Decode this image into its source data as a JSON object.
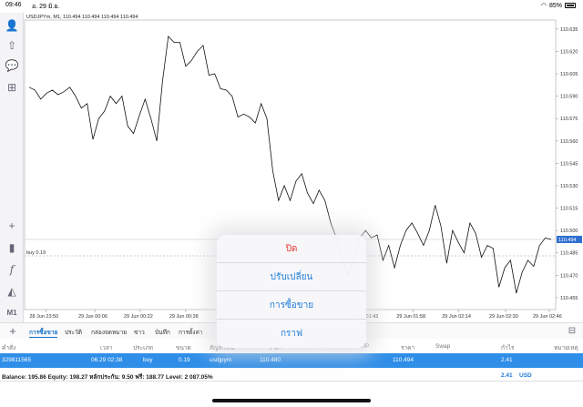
{
  "status": {
    "time": "09:46",
    "date": "อ. 29 มิ.ย.",
    "battery": "85%"
  },
  "chart": {
    "symbol_header": "USDJPYm, M1, 110.494 110.494 110.494 110.494",
    "price_labels": [
      "110.635",
      "110.620",
      "110.605",
      "110.590",
      "110.575",
      "110.560",
      "110.545",
      "110.530",
      "110.515",
      "110.500",
      "110.485",
      "110.470",
      "110.455"
    ],
    "current_price": "110.494",
    "order_line_label": "buy 0.19",
    "time_labels": [
      "28 Jun 23:50",
      "29 Jun 00:06",
      "29 Jun 00:22",
      "29 Jun 00:38",
      "29 Jun 01:42",
      "29 Jun 01:58",
      "29 Jun 02:14",
      "29 Jun 02:30",
      "29 Jun 02:46"
    ],
    "period_badge": "M1"
  },
  "chart_data": {
    "type": "line",
    "x": [
      "23:45",
      "23:47",
      "23:49",
      "23:51",
      "23:53",
      "23:55",
      "23:57",
      "23:59",
      "00:01",
      "00:03",
      "00:05",
      "00:07",
      "00:09",
      "00:11",
      "00:13",
      "00:15",
      "00:17",
      "00:19",
      "00:21",
      "00:23",
      "00:25",
      "00:27",
      "00:29",
      "00:31",
      "00:33",
      "00:35",
      "00:37",
      "00:39",
      "00:41",
      "00:43",
      "00:45",
      "00:47",
      "00:49",
      "00:51",
      "00:53",
      "00:55",
      "00:57",
      "00:59",
      "01:01",
      "01:03",
      "01:05",
      "01:07",
      "01:09",
      "01:11",
      "01:13",
      "01:15",
      "01:17",
      "01:19",
      "01:21",
      "01:23",
      "01:25",
      "01:27",
      "01:29",
      "01:31",
      "01:33",
      "01:35",
      "01:37",
      "01:39",
      "01:41",
      "01:43",
      "01:45",
      "01:47",
      "01:49",
      "01:51",
      "01:53",
      "01:55",
      "01:57",
      "01:59",
      "02:01",
      "02:03",
      "02:05",
      "02:07",
      "02:09",
      "02:11",
      "02:13",
      "02:15",
      "02:17",
      "02:19",
      "02:21",
      "02:23",
      "02:25",
      "02:27",
      "02:29",
      "02:31",
      "02:33",
      "02:35",
      "02:37",
      "02:39",
      "02:41",
      "02:43",
      "02:45"
    ],
    "values": [
      110.596,
      110.594,
      110.588,
      110.592,
      110.594,
      110.591,
      110.593,
      110.596,
      110.59,
      110.582,
      110.585,
      110.561,
      110.575,
      110.58,
      110.59,
      110.585,
      110.59,
      110.57,
      110.565,
      110.577,
      110.588,
      110.575,
      110.56,
      110.6,
      110.63,
      110.626,
      110.626,
      110.61,
      110.614,
      110.62,
      110.624,
      110.604,
      110.605,
      110.595,
      110.594,
      110.59,
      110.576,
      110.578,
      110.576,
      110.572,
      110.585,
      110.575,
      110.54,
      110.52,
      110.53,
      110.52,
      110.533,
      110.538,
      110.525,
      110.518,
      110.527,
      110.52,
      110.505,
      110.495,
      110.482,
      110.47,
      110.48,
      110.495,
      110.5,
      110.495,
      110.497,
      110.48,
      110.49,
      110.475,
      110.49,
      110.5,
      110.505,
      110.498,
      110.49,
      110.5,
      110.517,
      110.503,
      110.478,
      110.5,
      110.492,
      110.485,
      110.505,
      110.498,
      110.482,
      110.49,
      110.488,
      110.462,
      110.475,
      110.48,
      110.458,
      110.472,
      110.48,
      110.476,
      110.49,
      110.495,
      110.494
    ],
    "ylim": [
      110.447,
      110.641
    ],
    "current": 110.494,
    "order_level": 110.483
  },
  "tabs": [
    "การซื้อขาย",
    "ประวัติ",
    "กล่องจดหมาย",
    "ข่าว",
    "บันทึก",
    "การตั้งค่า"
  ],
  "table": {
    "headers": [
      "คำสั่ง",
      "เวลา",
      "ประเภท",
      "ขนาด",
      "สัญลักษณ์",
      "ราคา",
      "S/L",
      "T/P",
      "ราคา",
      "Swap",
      "กำไร",
      "หมายเหตุ"
    ],
    "row": {
      "order": "329811565",
      "time": "06.29 02:38",
      "type": "buy",
      "size": "0.19",
      "symbol": "usdjpym",
      "price": "110.480",
      "price_now": "110.494",
      "profit": "2.41"
    },
    "balance_line": "Balance: 195.86 Equity: 198.27 หลักประกัน: 9.50 ฟรี: 188.77 Level: 2 087.05%",
    "total_profit": "2.41",
    "currency": "USD"
  },
  "action_sheet": {
    "close": "ปิด",
    "modify": "ปรับเปลี่ยน",
    "trade": "การซื้อขาย",
    "chart": "กราฟ"
  }
}
